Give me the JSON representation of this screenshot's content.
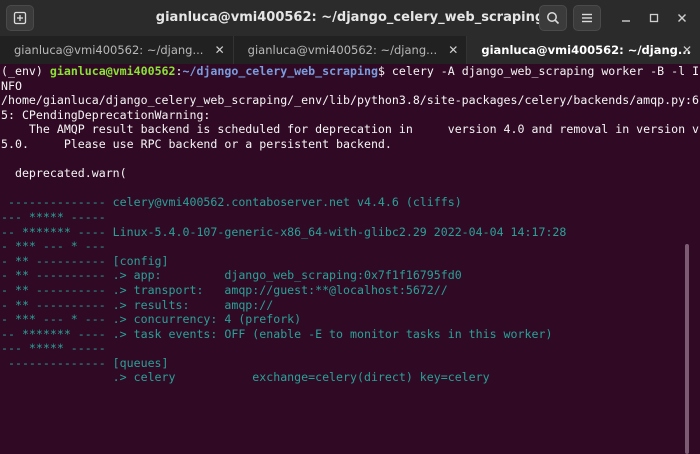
{
  "window": {
    "title": "gianluca@vmi400562: ~/django_celery_web_scraping",
    "icons": {
      "new_tab": "new-tab-icon",
      "search": "search-icon",
      "menu": "hamburger-menu-icon",
      "minimize": "minimize-icon",
      "maximize": "maximize-icon",
      "close": "close-icon"
    }
  },
  "tabs": [
    {
      "label": "gianluca@vmi400562: ~/djang...",
      "active": false
    },
    {
      "label": "gianluca@vmi400562: ~/djang...",
      "active": false
    },
    {
      "label": "gianluca@vmi400562: ~/djang...",
      "active": true
    }
  ],
  "terminal": {
    "prompt": {
      "env": "(_env) ",
      "userhost": "gianluca@vmi400562",
      "colon": ":",
      "path": "~/django_celery_web_scraping",
      "dollar": "$ ",
      "command": "celery -A django_web_scraping worker -B -l I"
    },
    "lines": [
      {
        "text": "NFO",
        "style": "w"
      },
      {
        "text": "/home/gianluca/django_celery_web_scraping/_env/lib/python3.8/site-packages/celery/backends/amqp.py:6",
        "style": "w"
      },
      {
        "text": "5: CPendingDeprecationWarning:",
        "style": "w"
      },
      {
        "text": "    The AMQP result backend is scheduled for deprecation in     version 4.0 and removal in version v",
        "style": "w"
      },
      {
        "text": "5.0.     Please use RPC backend or a persistent backend.",
        "style": "w"
      },
      {
        "text": "",
        "style": "w"
      },
      {
        "text": "  deprecated.warn(",
        "style": "w"
      },
      {
        "text": "",
        "style": "w"
      },
      {
        "text": " -------------- celery@vmi400562.contaboserver.net v4.4.6 (cliffs)",
        "style": "t"
      },
      {
        "text": "--- ***** -----",
        "style": "t"
      },
      {
        "text": "-- ******* ---- Linux-5.4.0-107-generic-x86_64-with-glibc2.29 2022-04-04 14:17:28",
        "style": "t"
      },
      {
        "text": "- *** --- * ---",
        "style": "t"
      },
      {
        "text": "- ** ---------- [config]",
        "style": "t"
      },
      {
        "text": "- ** ---------- .> app:         django_web_scraping:0x7f1f16795fd0",
        "style": "t"
      },
      {
        "text": "- ** ---------- .> transport:   amqp://guest:**@localhost:5672//",
        "style": "t"
      },
      {
        "text": "- ** ---------- .> results:     amqp://",
        "style": "t"
      },
      {
        "text": "- *** --- * --- .> concurrency: 4 (prefork)",
        "style": "t"
      },
      {
        "text": "-- ******* ---- .> task events: OFF (enable -E to monitor tasks in this worker)",
        "style": "t"
      },
      {
        "text": "--- ***** -----",
        "style": "t"
      },
      {
        "text": " -------------- [queues]",
        "style": "t"
      },
      {
        "text": "                .> celery           exchange=celery(direct) key=celery",
        "style": "t"
      }
    ]
  }
}
